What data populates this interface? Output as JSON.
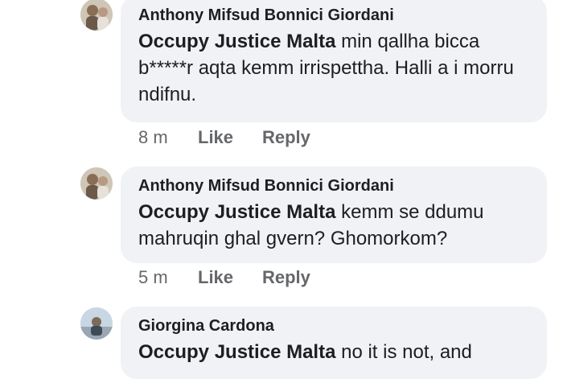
{
  "comments": [
    {
      "author": "Anthony Mifsud Bonnici Giordani",
      "mention": "Occupy Justice Malta",
      "text": " min qallha bicca b*****r aqta kemm irrispettha. Halli a i morru ndifnu.",
      "time": "8 m",
      "like_label": "Like",
      "reply_label": "Reply"
    },
    {
      "author": "Anthony Mifsud Bonnici Giordani",
      "mention": "Occupy Justice Malta",
      "text": " kemm se ddumu mahruqin ghal gvern? Ghomorkom?",
      "time": "5 m",
      "like_label": "Like",
      "reply_label": "Reply"
    },
    {
      "author": "Giorgina Cardona",
      "mention": "Occupy Justice Malta",
      "text": " no it is not, and"
    }
  ],
  "colors": {
    "bubble": "#f0f2f5",
    "meta": "#65676b",
    "text": "#1c1e21"
  }
}
